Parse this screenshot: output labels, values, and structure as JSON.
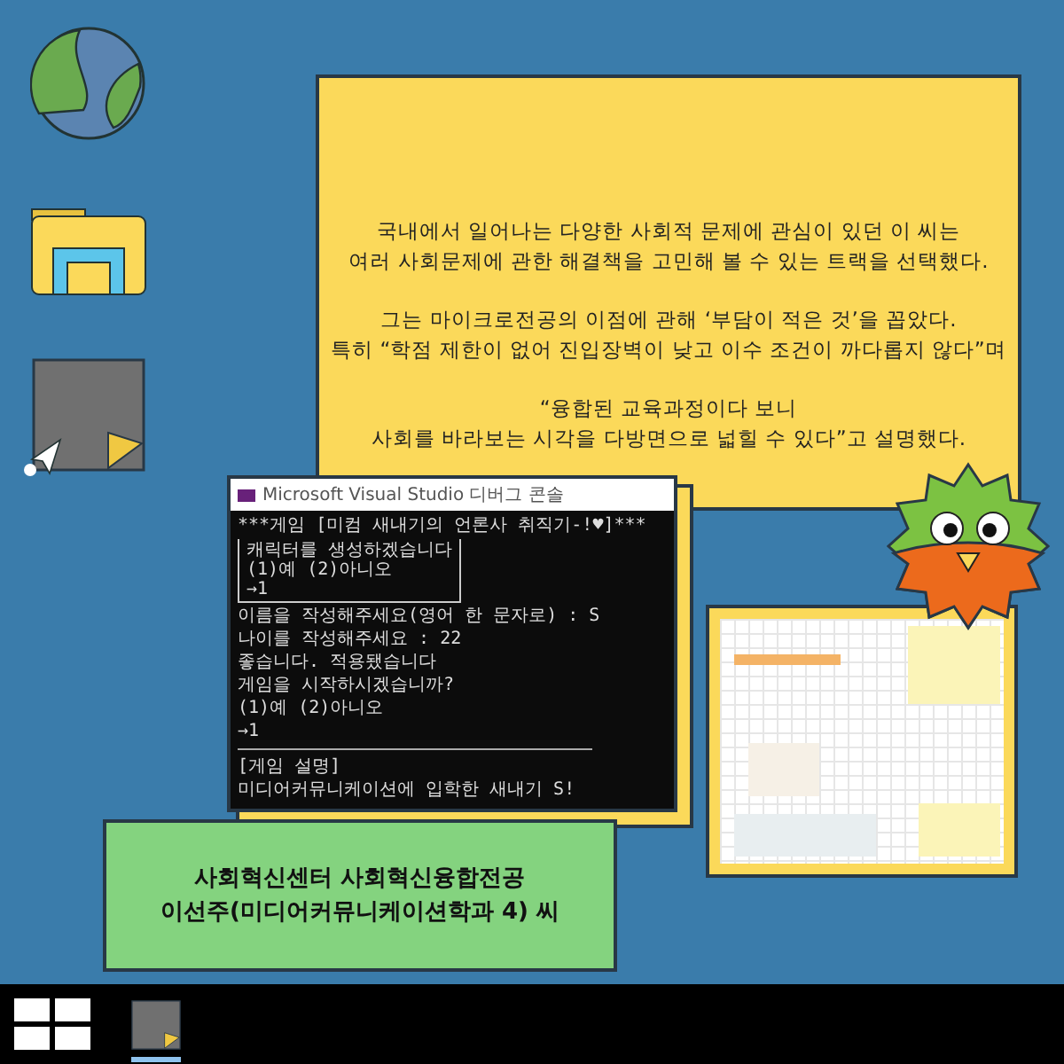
{
  "desktop_icons": [
    {
      "kind": "globe"
    },
    {
      "kind": "folder"
    },
    {
      "kind": "file"
    }
  ],
  "article_window": {
    "paragraphs": [
      [
        "국내에서 일어나는 다양한 사회적 문제에 관심이 있던 이 씨는",
        "여러 사회문제에 관한 해결책을 고민해 볼 수 있는 트랙을 선택했다."
      ],
      [
        "그는 마이크로전공의 이점에 관해 ‘부담이 적은 것’을 꼽았다.",
        "특히 “학점 제한이 없어 진입장벽이 낮고 이수 조건이 까다롭지 않다”며"
      ],
      [
        "“융합된 교육과정이다 보니",
        "사회를 바라보는 시각을 다방면으로 넓힐 수 있다”고 설명했다."
      ]
    ]
  },
  "console_window": {
    "title": "Microsoft Visual Studio 디버그 콘솔",
    "blocks": [
      {
        "kind": "text",
        "lines": [
          "***게임 [미컴 새내기의 언론사 취직기-!♥]***"
        ]
      },
      {
        "kind": "box",
        "lines": [
          "캐릭터를 생성하겠습니다",
          "(1)예 (2)아니오",
          "→1"
        ]
      },
      {
        "kind": "text",
        "lines": [
          "이름을 작성해주세요(영어 한 문자로) : S",
          "나이를 작성해주세요 : 22",
          "좋습니다. 적용됐습니다",
          "게임을 시작하시겠습니까?",
          "(1)예 (2)아니오",
          "→1"
        ]
      },
      {
        "kind": "rule"
      },
      {
        "kind": "text",
        "lines": [
          "[게임 설명]",
          "미디어커뮤니케이션에 입학한 새내기 S!"
        ]
      }
    ]
  },
  "caption_card": {
    "lines": [
      "사회혁신센터 사회혁신융합전공",
      "이선주(미디어커뮤니케이션학과 4) 씨"
    ]
  },
  "taskbar": {
    "apps": [
      {
        "kind": "file",
        "selected": true
      }
    ]
  }
}
